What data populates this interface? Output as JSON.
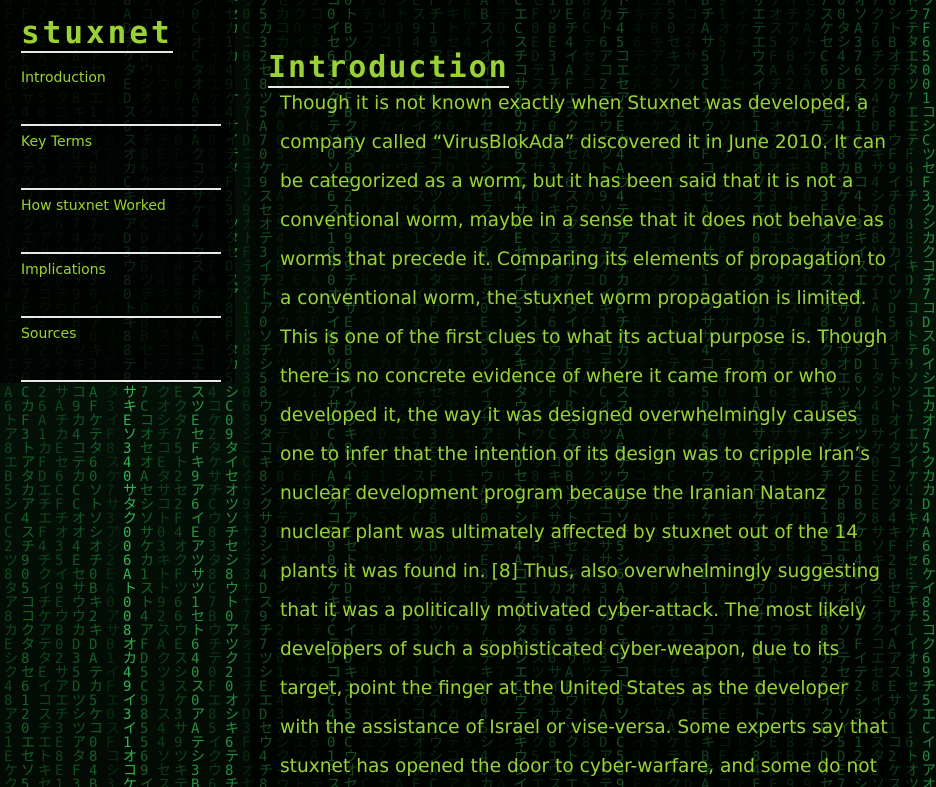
{
  "site": {
    "logo": "stuxnet"
  },
  "nav": {
    "items": [
      {
        "label": "Introduction"
      },
      {
        "label": "Key Terms"
      },
      {
        "label": "How stuxnet Worked"
      },
      {
        "label": "Implications"
      },
      {
        "label": "Sources"
      }
    ]
  },
  "main": {
    "title": "Introduction",
    "body": "Though it is not known exactly when Stuxnet was developed, a company called “VirusBlokAda” discovered it in June 2010. It can be categorized as a worm, but it has been said that it is not a conventional worm, maybe in a sense that it does not behave as worms that precede it. Comparing its elements of propagation to a conventional worm, the stuxnet worm propagation is limited. This is one of the first clues to what its actual purpose is. Though there is no concrete evidence of where it came from or who developed it, the way it was designed overwhelmingly causes one to infer that the intention of its design was to cripple Iran’s nuclear development program because the Iranian Natanz nuclear plant was ultimately affected by stuxnet out of the 14 plants it was found in. [8] Thus, also overwhelmingly suggesting that it was a politically motivated cyber-attack. The most likely developers of such a sophisticated cyber-weapon, due to its target, point the finger at the United States as the developer with the assistance of Israel or vise-versa. Some experts say that stuxnet has opened the door to cyber-warfare, and some do not"
  },
  "colors": {
    "accent": "#9ad137",
    "rule": "#e8e8e8",
    "background": "#000000",
    "matrix": "#1f8f3a"
  }
}
